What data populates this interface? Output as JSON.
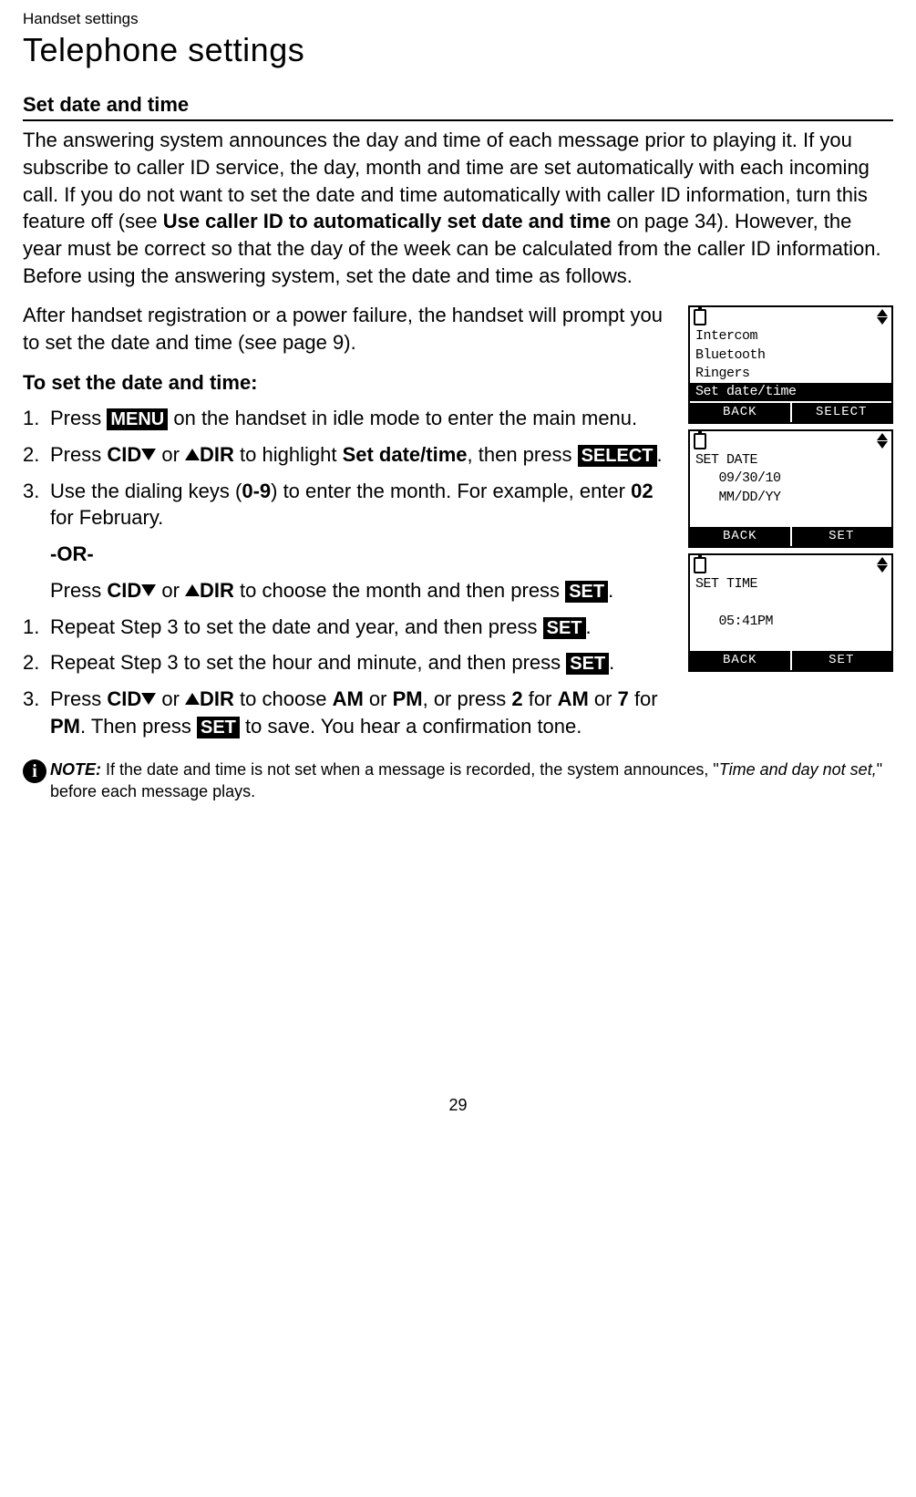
{
  "breadcrumb": "Handset settings",
  "pageTitle": "Telephone settings",
  "sectionHeading": "Set date and time",
  "intro": {
    "p1a": "The answering system announces the day and time of each message prior to playing it. If you subscribe to caller ID service, the day, month and time are set automatically with each incoming call. If you do not want to set the date and time automatically with caller ID information, turn this feature off (see ",
    "p1bold": "Use caller ID to automatically set date and time",
    "p1b": " on page 34). However, the year must be correct so that the day of the week can be calculated from the caller ID information. Before using the answering system, set the date and time as follows.",
    "p2": "After handset registration or a power failure, the handset will prompt you to set the date and time (see page 9)."
  },
  "subheading": "To set the date and time:",
  "stepsA": {
    "s1a": "Press ",
    "s1key": "MENU",
    "s1b": " on the handset in idle mode to enter the main menu.",
    "s2a": "Press ",
    "s2cid": "CID",
    "s2or": " or ",
    "s2dir": "DIR",
    "s2b": " to highlight ",
    "s2bold": "Set date/time",
    "s2c": ", then press ",
    "s2key": "SELECT",
    "s2d": ".",
    "s3a": "Use the dialing keys (",
    "s3bold1": "0-9",
    "s3b": ") to enter the month. For example, enter ",
    "s3bold2": "02",
    "s3c": " for February."
  },
  "orLabel": "-OR-",
  "orPara": {
    "a": "Press ",
    "cid": "CID",
    "or": " or ",
    "dir": "DIR",
    "b": " to choose the month and then press ",
    "key": "SET",
    "c": "."
  },
  "stepsB": {
    "s1a": "Repeat Step 3 to set the date and year, and then press ",
    "s1key": "SET",
    "s1b": ".",
    "s2a": "Repeat Step 3 to set the hour and minute, and then press ",
    "s2key": "SET",
    "s2b": ".",
    "s3a": "Press ",
    "s3cid": "CID",
    "s3or": " or ",
    "s3dir": "DIR",
    "s3b": " to choose ",
    "s3am": "AM",
    "s3or2": " or ",
    "s3pm": "PM",
    "s3c": ", or press ",
    "s3two": "2",
    "s3for1": " for ",
    "s3am2": "AM",
    "s3or3": " or ",
    "s3seven": "7",
    "s3for2": " for ",
    "s3pm2": "PM",
    "s3d": ". Then press ",
    "s3key": "SET",
    "s3e": " to save. You hear a confirmation tone."
  },
  "note": {
    "label": "NOTE:",
    "a": " If the date and time is not set when a message is recorded, the system announces, \"",
    "ital": "Time and day not set,",
    "b": "\" before each message plays."
  },
  "screens": {
    "menu": {
      "l1": "Intercom",
      "l2": "Bluetooth",
      "l3": "Ringers",
      "l4": "Set date/time",
      "skL": "BACK",
      "skR": "SELECT"
    },
    "date": {
      "l1": "SET DATE",
      "l2": "   09/30/10",
      "l3": "   MM/DD/YY",
      "skL": "BACK",
      "skR": "SET"
    },
    "time": {
      "l1": "SET TIME",
      "l2": "   05:41PM",
      "skL": "BACK",
      "skR": "SET"
    }
  },
  "pageNumber": "29"
}
